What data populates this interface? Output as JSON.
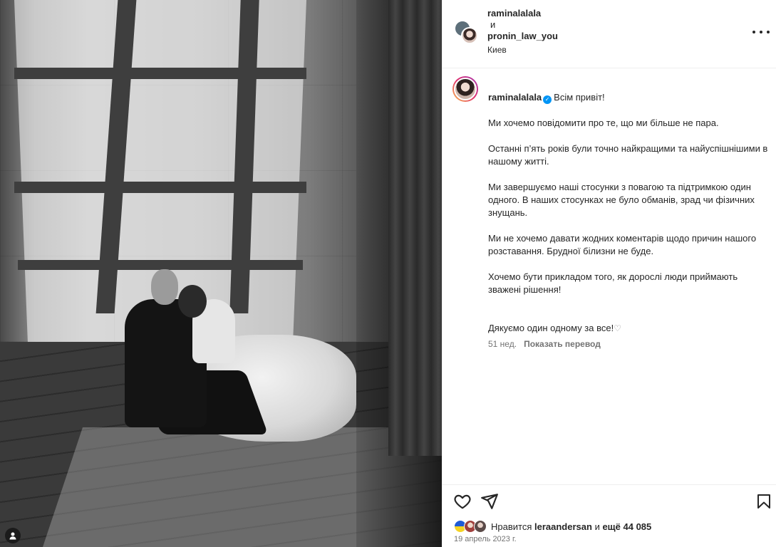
{
  "header": {
    "user1": "raminalalala",
    "connector": "и",
    "user2": "pronin_law_you",
    "location": "Киев"
  },
  "caption": {
    "username": "raminalalala",
    "verified": true,
    "greeting": "Всім привіт!",
    "line1": "Ми хочемо повідомити про те, що ми більше не пара.",
    "paragraphs": [
      "Останні п’ять років були точно найкращими та найуспішнішими в нашому житті.",
      "Ми завершуємо наші стосунки з повагою та підтримкою один одного. В наших стосунках не було обманів, зрад чи фізичних знущань.",
      "Ми не хочемо давати жодних коментарів щодо причин нашого розставання. Брудної білизни не буде.",
      "Хочемо бути прикладом того, як дорослі люди приймають зважені рішення!",
      "Дякуємо один одному за все!"
    ],
    "time_ago": "51 нед.",
    "translate": "Показать перевод"
  },
  "likes": {
    "prefix": "Нравится",
    "user": "leraandersan",
    "middle": "и",
    "count": "ещё 44 085"
  },
  "date": "19 апрель 2023 г.",
  "icons": [
    "more-options-icon",
    "heart-icon",
    "share-icon",
    "bookmark-icon",
    "user-tag-icon"
  ],
  "colors": {
    "verified": "#0095f6",
    "text": "#262626",
    "secondary": "#737373",
    "border": "#efefef"
  }
}
